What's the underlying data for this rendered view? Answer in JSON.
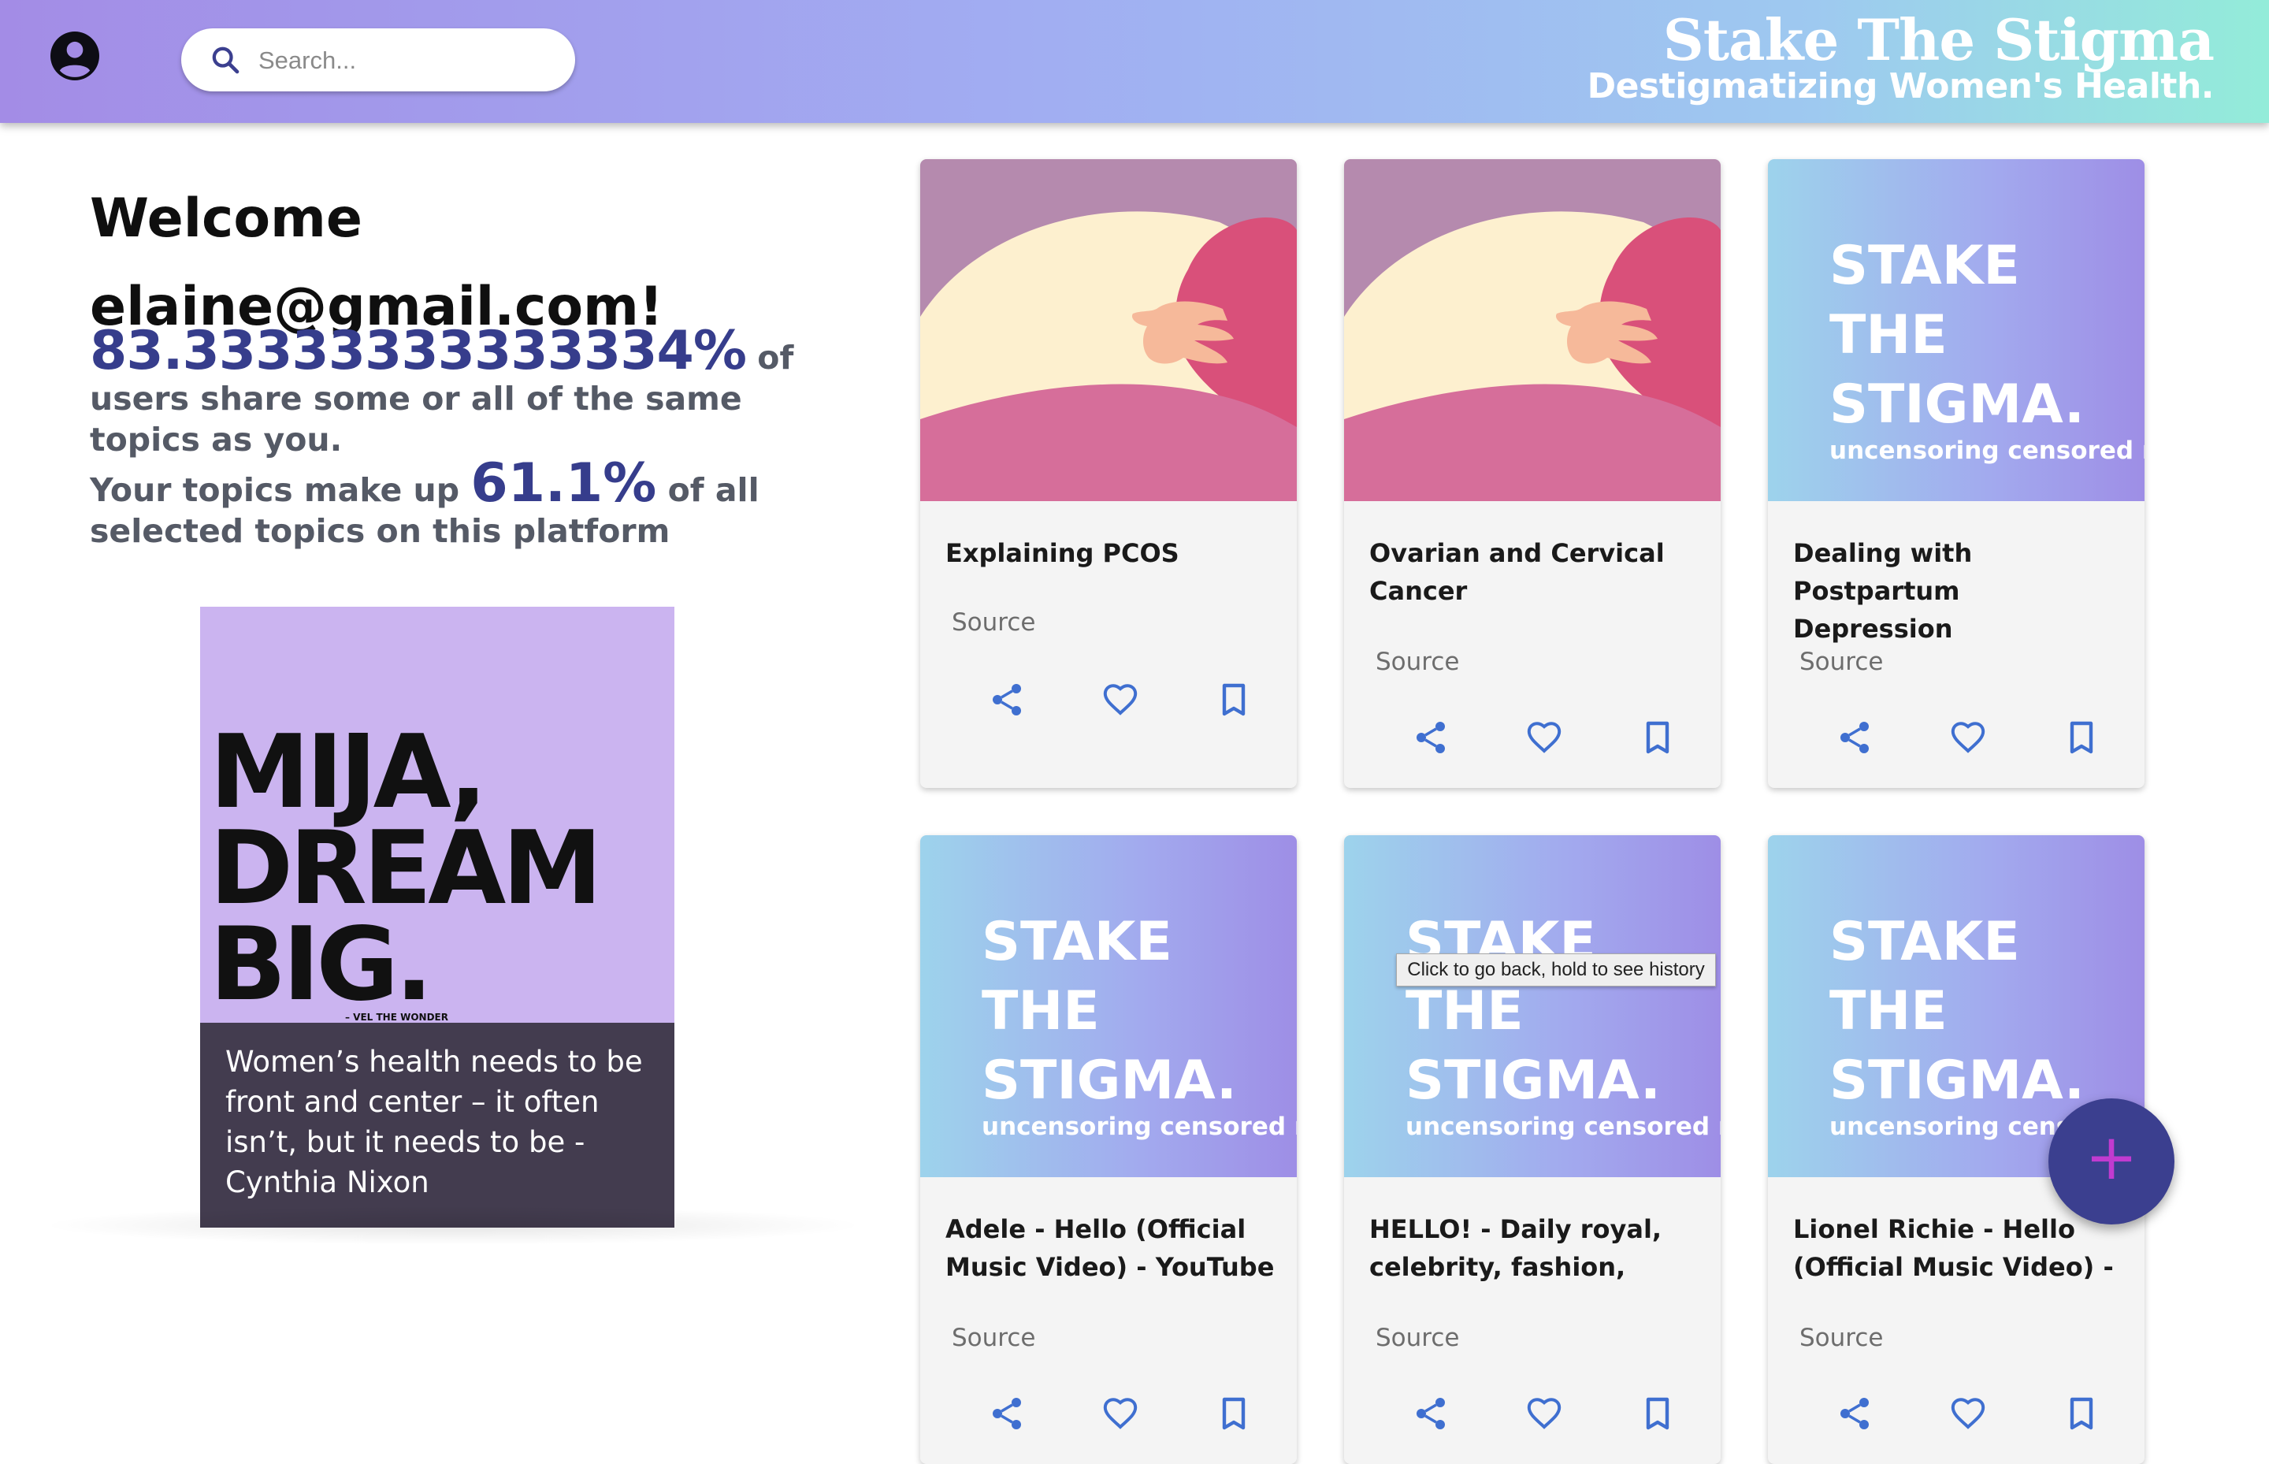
{
  "header": {
    "search_placeholder": "Search...",
    "brand_title": "Stake The Stigma",
    "brand_subtitle": "Destigmatizing Women's Health."
  },
  "welcome": {
    "line1": "Welcome",
    "line2": "elaine@gmail.com!",
    "share_percent": "83.33333333333334%",
    "share_text": " of users share some or all of the same topics as you.",
    "topics_prefix": "Your topics make up ",
    "topics_percent": "61.1%",
    "topics_suffix": " of all selected topics on this platform"
  },
  "quote": {
    "poster_line1": "MIJA,",
    "poster_line2": "DREAM",
    "poster_line3": "BIG.",
    "poster_credit": "– VEL THE WONDER",
    "text": "Women’s health needs to be front and center – it often isn’t, but it needs to be - Cynthia Nixon"
  },
  "stake_image": {
    "text": "STAKE\nTHE\nSTIGMA.",
    "subtext": "uncensoring censored news"
  },
  "cards": [
    {
      "title": "Explaining PCOS",
      "source": "Source"
    },
    {
      "title": "Ovarian and Cervical Cancer",
      "source": "Source"
    },
    {
      "title": "Dealing with Postpartum Depression",
      "source": "Source"
    },
    {
      "title": "Adele - Hello (Official Music Video) - YouTube",
      "source": "Source"
    },
    {
      "title": "HELLO! - Daily royal, celebrity, fashion,",
      "source": "Source"
    },
    {
      "title": "Lionel Richie - Hello (Official Music Video) -",
      "source": "Source"
    }
  ],
  "tooltip": "Click to go back, hold to see history",
  "fab_label": "+",
  "icons": {
    "avatar": "account-circle-icon",
    "search": "search-icon",
    "share": "share-icon",
    "like": "heart-outline-icon",
    "bookmark": "bookmark-outline-icon"
  },
  "colors": {
    "accent": "#363d8c",
    "action_icon": "#3f6fd0",
    "fab": "#3b3f8f"
  }
}
